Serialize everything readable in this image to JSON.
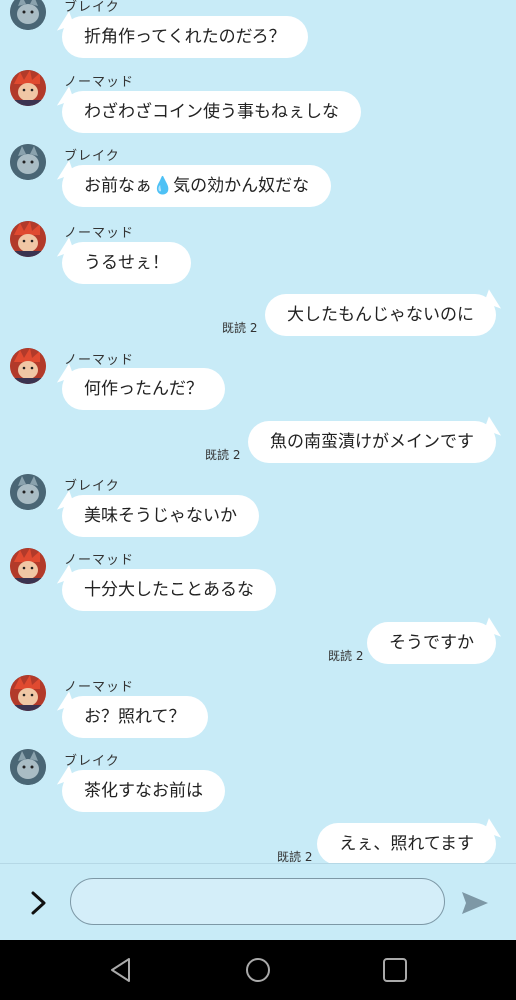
{
  "messages": [
    {
      "sender": "ブレイク",
      "text": "折角作ってくれたのだろ？",
      "side": "left"
    },
    {
      "sender": "ノーマッド",
      "text": "わざわざコイン使う事もねぇしな",
      "side": "left"
    },
    {
      "sender": "ブレイク",
      "text": "お前なぁ💧気の効かん奴だな",
      "side": "left"
    },
    {
      "sender": "ノーマッド",
      "text": "うるせぇ！",
      "side": "left"
    },
    {
      "text": "大したもんじゃないのに",
      "side": "right",
      "read": "既読 2"
    },
    {
      "sender": "ノーマッド",
      "text": "何作ったんだ？",
      "side": "left"
    },
    {
      "text": "魚の南蛮漬けがメインです",
      "side": "right",
      "read": "既読 2"
    },
    {
      "sender": "ブレイク",
      "text": "美味そうじゃないか",
      "side": "left"
    },
    {
      "sender": "ノーマッド",
      "text": "十分大したことあるな",
      "side": "left"
    },
    {
      "text": "そうですか",
      "side": "right",
      "read": "既読 2"
    },
    {
      "sender": "ノーマッド",
      "text": "お？照れて？",
      "side": "left"
    },
    {
      "sender": "ブレイク",
      "text": "茶化すなお前は",
      "side": "left"
    },
    {
      "text": "えぇ、照れてます",
      "side": "right",
      "read": "既読 2"
    }
  ],
  "input": {
    "placeholder": "",
    "value": ""
  },
  "icons": {
    "expand": "chevron-right-icon",
    "send": "send-icon",
    "back": "back-triangle-icon",
    "home": "home-circle-icon",
    "recents": "recents-square-icon"
  },
  "colors": {
    "background": "#c8ebf7",
    "bubble": "#ffffff",
    "navbar": "#000000"
  }
}
